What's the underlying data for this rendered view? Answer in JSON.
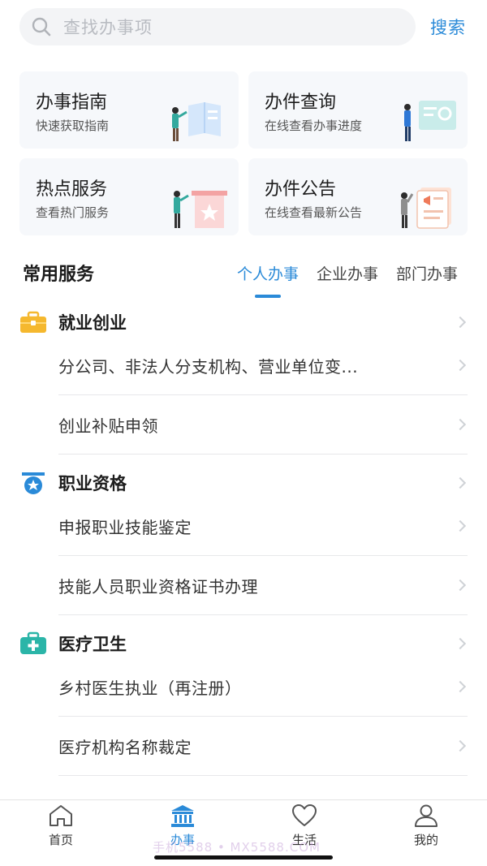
{
  "search": {
    "placeholder": "查找办事项",
    "button": "搜索"
  },
  "cards": [
    {
      "title": "办事指南",
      "subtitle": "快速获取指南",
      "illustration": "guide-book-illustration"
    },
    {
      "title": "办件查询",
      "subtitle": "在线查看办事进度",
      "illustration": "query-screen-illustration"
    },
    {
      "title": "热点服务",
      "subtitle": "查看热门服务",
      "illustration": "hot-service-illustration"
    },
    {
      "title": "办件公告",
      "subtitle": "在线查看最新公告",
      "illustration": "announcement-illustration"
    }
  ],
  "section": {
    "title": "常用服务",
    "tabs": [
      {
        "label": "个人办事",
        "active": true
      },
      {
        "label": "企业办事",
        "active": false
      },
      {
        "label": "部门办事",
        "active": false
      }
    ]
  },
  "groups": [
    {
      "title": "就业创业",
      "icon": "briefcase-icon",
      "icon_color": "#f5b82e",
      "items": [
        "分公司、非法人分支机构、营业单位变...",
        "创业补贴申领"
      ]
    },
    {
      "title": "职业资格",
      "icon": "medal-icon",
      "icon_color": "#2a8ad8",
      "items": [
        "申报职业技能鉴定",
        "技能人员职业资格证书办理"
      ]
    },
    {
      "title": "医疗卫生",
      "icon": "medical-kit-icon",
      "icon_color": "#2bb5a8",
      "items": [
        "乡村医生执业（再注册）",
        "医疗机构名称裁定"
      ]
    }
  ],
  "nav": [
    {
      "label": "首页",
      "icon": "home-icon",
      "active": false
    },
    {
      "label": "办事",
      "icon": "government-building-icon",
      "active": true
    },
    {
      "label": "生活",
      "icon": "heart-icon",
      "active": false
    },
    {
      "label": "我的",
      "icon": "user-icon",
      "active": false
    }
  ],
  "watermark": "手机5588 • MX5588.COM",
  "colors": {
    "accent": "#2a8ad8",
    "card_bg": "#f6f8fb",
    "search_bg": "#f3f4f6"
  }
}
